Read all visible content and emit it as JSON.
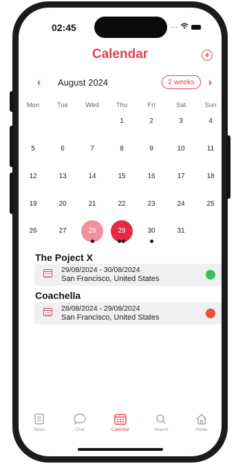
{
  "status": {
    "time": "02:45"
  },
  "header": {
    "title": "Calendar",
    "add_icon": "plus-circle-icon"
  },
  "month_nav": {
    "label": "August 2024",
    "view_toggle": "2 weeks",
    "prev_icon": "‹",
    "next_icon": "›"
  },
  "weekdays": [
    "Mon",
    "Tue",
    "Wed",
    "Thu",
    "Fri",
    "Sat",
    "Sun"
  ],
  "weeks": [
    [
      "",
      "",
      "",
      "1",
      "2",
      "3",
      "4"
    ],
    [
      "5",
      "6",
      "7",
      "8",
      "9",
      "10",
      "11"
    ],
    [
      "12",
      "13",
      "14",
      "15",
      "16",
      "17",
      "18"
    ],
    [
      "19",
      "20",
      "21",
      "22",
      "23",
      "24",
      "25"
    ],
    [
      "26",
      "27",
      "28",
      "29",
      "30",
      "31",
      ""
    ]
  ],
  "highlighted_days": {
    "28": "#f0919c",
    "29": "#e52a43"
  },
  "events": [
    {
      "title": "The Poject X",
      "dates": "29/08/2024 - 30/08/2024",
      "location": "San Francisco, United States",
      "status_color": "#3cbf55"
    },
    {
      "title": "Coachella",
      "dates": "28/08/2024 - 29/08/2024",
      "location": "San Francisco, United States",
      "status_color": "#e8503a"
    }
  ],
  "tabs": [
    {
      "label": "News",
      "icon": "newspaper-icon",
      "active": false
    },
    {
      "label": "Chat",
      "icon": "chat-bubble-icon",
      "active": false
    },
    {
      "label": "Calendar",
      "icon": "calendar-icon",
      "active": true
    },
    {
      "label": "Search",
      "icon": "search-icon",
      "active": false
    },
    {
      "label": "Home",
      "icon": "home-icon",
      "active": false
    }
  ],
  "colors": {
    "accent": "#e4404f"
  }
}
